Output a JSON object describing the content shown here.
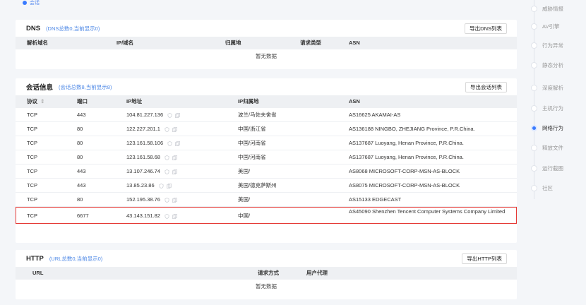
{
  "top_tag": "会话",
  "dns": {
    "title": "DNS",
    "subtitle": "(DNS总数0,当前显示0)",
    "export_label": "导出DNS列表",
    "columns": [
      "解析域名",
      "IP/域名",
      "归属地",
      "请求类型",
      "ASN"
    ],
    "empty": "暂无数据"
  },
  "sessions": {
    "title": "会话信息",
    "subtitle": "(会话总数8,当前显示8)",
    "export_label": "导出会话列表",
    "columns": [
      "协议",
      "端口",
      "IP地址",
      "IP归属地",
      "ASN"
    ],
    "sort_icon": "⇕",
    "rows": [
      {
        "protocol": "TCP",
        "port": "443",
        "ip": "104.81.227.136",
        "location": "波兰/马佐夫舍省",
        "asn": "AS16625 AKAMAI-AS"
      },
      {
        "protocol": "TCP",
        "port": "80",
        "ip": "122.227.201.1",
        "location": "中国/浙江省",
        "asn": "AS136188 NINGBO, ZHEJIANG Province, P.R.China."
      },
      {
        "protocol": "TCP",
        "port": "80",
        "ip": "123.161.58.106",
        "location": "中国/河南省",
        "asn": "AS137687 Luoyang, Henan Province, P.R.China."
      },
      {
        "protocol": "TCP",
        "port": "80",
        "ip": "123.161.58.68",
        "location": "中国/河南省",
        "asn": "AS137687 Luoyang, Henan Province, P.R.China."
      },
      {
        "protocol": "TCP",
        "port": "443",
        "ip": "13.107.246.74",
        "location": "美国/",
        "asn": "AS8068 MICROSOFT-CORP-MSN-AS-BLOCK"
      },
      {
        "protocol": "TCP",
        "port": "443",
        "ip": "13.85.23.86",
        "location": "美国/德克萨斯州",
        "asn": "AS8075 MICROSOFT-CORP-MSN-AS-BLOCK"
      },
      {
        "protocol": "TCP",
        "port": "80",
        "ip": "152.195.38.76",
        "location": "美国/",
        "asn": "AS15133 EDGECAST"
      },
      {
        "protocol": "TCP",
        "port": "6677",
        "ip": "43.143.151.82",
        "location": "中国/",
        "asn": "AS45090 Shenzhen Tencent Computer Systems Company Limited"
      }
    ]
  },
  "http": {
    "title": "HTTP",
    "subtitle": "(URL总数0,当前显示0)",
    "export_label": "导出HTTP列表",
    "columns": [
      "URL",
      "请求方式",
      "用户代理"
    ],
    "empty": "暂无数据"
  },
  "sidebar": {
    "items": [
      {
        "label": "威胁情报",
        "active": false
      },
      {
        "label": "AV引擎",
        "active": false
      },
      {
        "label": "行为异常",
        "active": false
      },
      {
        "label": "静态分析",
        "active": false
      },
      {
        "label": "深度解析",
        "active": false
      },
      {
        "label": "主机行为",
        "active": false
      },
      {
        "label": "网络行为",
        "active": true
      },
      {
        "label": "释放文件",
        "active": false
      },
      {
        "label": "运行截图",
        "active": false
      },
      {
        "label": "社区",
        "active": false
      }
    ]
  },
  "colors": {
    "accent": "#3a7bff",
    "highlight_border": "#e53935",
    "subtitle": "#4e88e6"
  }
}
